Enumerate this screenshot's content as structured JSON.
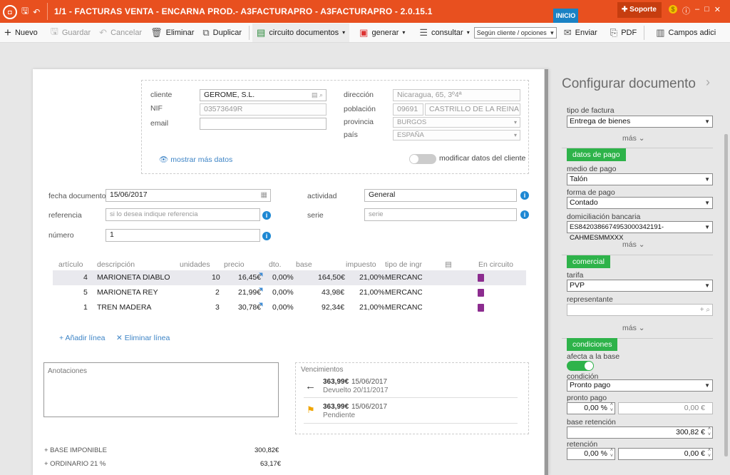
{
  "app": {
    "title": "1/1 - FACTURAS VENTA - ENCARNA PROD.- A3FACTURAPRO - A3FACTURAPRO - 2.0.15.1",
    "tab_inicio": "INICIO",
    "soporte": "Soporte"
  },
  "toolbar": {
    "nuevo": "Nuevo",
    "guardar": "Guardar",
    "cancelar": "Cancelar",
    "eliminar": "Eliminar",
    "duplicar": "Duplicar",
    "circuito": "circuito documentos",
    "generar": "generar",
    "consultar": "consultar",
    "selector": "Según cliente / opciones",
    "enviar": "Enviar",
    "pdf": "PDF",
    "campos": "Campos adici"
  },
  "client": {
    "cliente_label": "cliente",
    "cliente": "GEROME, S.L.",
    "nif_label": "NIF",
    "nif": "03573649R",
    "email_label": "email",
    "email": "",
    "direccion_label": "dirección",
    "direccion": "Nicaragua, 65, 3º4ª",
    "poblacion_label": "población",
    "cp": "09691",
    "poblacion": "CASTRILLO DE LA REINA",
    "provincia_label": "provincia",
    "provincia": "BURGOS",
    "pais_label": "país",
    "pais": "ESPAÑA",
    "mostrar": "mostrar más datos",
    "modificar": "modificar datos del cliente"
  },
  "header": {
    "fecha_label": "fecha documento",
    "fecha": "15/06/2017",
    "referencia_label": "referencia",
    "referencia_ph": "si lo desea indique referencia",
    "numero_label": "número",
    "numero": "1",
    "actividad_label": "actividad",
    "actividad": "General",
    "serie_label": "serie",
    "serie_ph": "serie"
  },
  "lines": {
    "headers": {
      "articulo": "artículo",
      "descripcion": "descripción",
      "unidades": "unidades",
      "precio": "precio",
      "dto": "dto.",
      "base": "base",
      "impuesto": "impuesto",
      "tipo": "tipo de ingr",
      "circuito": "En circuito"
    },
    "rows": [
      {
        "articulo": "4",
        "descripcion": "MARIONETA DIABLO",
        "unidades": "10",
        "precio": "16,45€",
        "dto": "0,00%",
        "base": "164,50€",
        "impuesto": "21,00%",
        "tipo": "MERCANCÍAS"
      },
      {
        "articulo": "5",
        "descripcion": "MARIONETA REY",
        "unidades": "2",
        "precio": "21,99€",
        "dto": "0,00%",
        "base": "43,98€",
        "impuesto": "21,00%",
        "tipo": "MERCANCÍAS"
      },
      {
        "articulo": "1",
        "descripcion": "TREN MADERA",
        "unidades": "3",
        "precio": "30,78€",
        "dto": "0,00%",
        "base": "92,34€",
        "impuesto": "21,00%",
        "tipo": "MERCANCÍAS"
      }
    ],
    "add": "Añadir línea",
    "del": "Eliminar línea"
  },
  "anotaciones": "Anotaciones",
  "vencimientos": {
    "title": "Vencimientos",
    "items": [
      {
        "amount": "363,99€",
        "date": "15/06/2017",
        "status": "Devuelto 20/11/2017"
      },
      {
        "amount": "363,99€",
        "date": "15/06/2017",
        "status": "Pendiente"
      }
    ]
  },
  "totals": {
    "base_label": "+ BASE IMPONIBLE",
    "base": "300,82€",
    "ord_label": "+ ORDINARIO 21 %",
    "ord": "63,17€"
  },
  "panel": {
    "title": "Configurar documento",
    "tipo_label": "tipo de factura",
    "tipo": "Entrega de bienes",
    "mas": "más",
    "datos_pago": "datos de pago",
    "medio_label": "medio de pago",
    "medio": "Talón",
    "forma_label": "forma de pago",
    "forma": "Contado",
    "domic_label": "domiciliación bancaria",
    "domic": "ES8420386674953000342191-CAHMESMMXXX",
    "comercial": "comercial",
    "tarifa_label": "tarifa",
    "tarifa": "PVP",
    "repre_label": "representante",
    "condiciones": "condiciones",
    "afecta_label": "afecta a la base",
    "condicion_label": "condición",
    "condicion": "Pronto pago",
    "pronto_label": "pronto pago",
    "pronto_pct": "0,00 %",
    "pronto_amt": "0,00 €",
    "base_ret_label": "base retención",
    "base_ret": "300,82 €",
    "ret_label": "retención",
    "ret_pct": "0,00 %",
    "ret_amt": "0,00 €"
  },
  "colors": {
    "brand": "#e8501f",
    "green": "#2eb34a",
    "link": "#3d84c6",
    "info": "#1e88d3"
  }
}
